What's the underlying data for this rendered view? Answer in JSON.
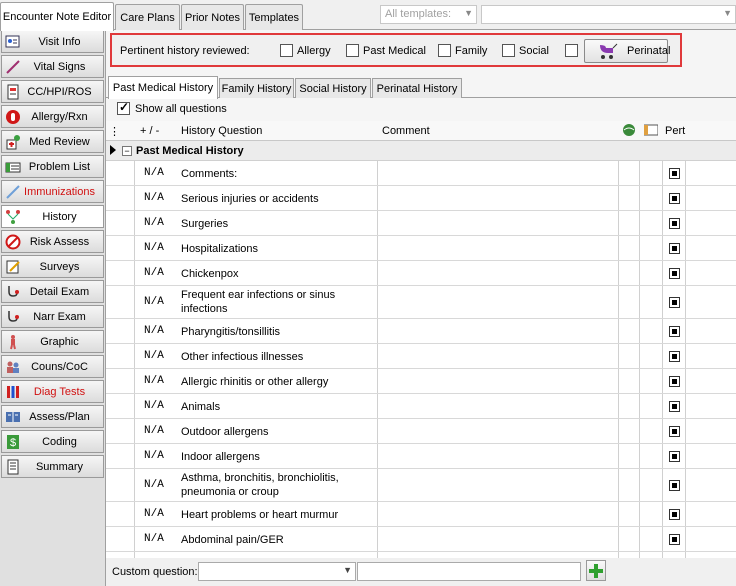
{
  "top_tabs": [
    "Encounter Note Editor",
    "Care Plans",
    "Prior Notes",
    "Templates"
  ],
  "templates_select": {
    "placeholder": "All templates:"
  },
  "sidebar": {
    "items": [
      {
        "label": "Visit Info",
        "icon": "visit-info-icon"
      },
      {
        "label": "Vital Signs",
        "icon": "thermometer-icon"
      },
      {
        "label": "CC/HPI/ROS",
        "icon": "document-icon"
      },
      {
        "label": "Allergy/Rxn",
        "icon": "allergy-icon"
      },
      {
        "label": "Med Review",
        "icon": "medication-icon"
      },
      {
        "label": "Problem List",
        "icon": "list-icon"
      },
      {
        "label": "Immunizations",
        "icon": "syringe-icon"
      },
      {
        "label": "History",
        "icon": "family-tree-icon"
      },
      {
        "label": "Risk Assess",
        "icon": "no-smoking-icon"
      },
      {
        "label": "Surveys",
        "icon": "survey-icon"
      },
      {
        "label": "Detail Exam",
        "icon": "stethoscope-icon"
      },
      {
        "label": "Narr Exam",
        "icon": "stethoscope-icon"
      },
      {
        "label": "Graphic",
        "icon": "body-icon"
      },
      {
        "label": "Couns/CoC",
        "icon": "counseling-icon"
      },
      {
        "label": "Diag Tests",
        "icon": "test-tubes-icon"
      },
      {
        "label": "Assess/Plan",
        "icon": "book-icon"
      },
      {
        "label": "Coding",
        "icon": "dollar-icon"
      },
      {
        "label": "Summary",
        "icon": "summary-icon"
      }
    ],
    "active": "History",
    "red_items": [
      "Immunizations",
      "Diag Tests"
    ]
  },
  "pertinent": {
    "title": "Pertinent history reviewed:",
    "items": [
      "Allergy",
      "Past Medical",
      "Family",
      "Social"
    ],
    "perinatal_button": "Perinatal"
  },
  "sub_tabs": [
    "Past Medical History",
    "Family History",
    "Social History",
    "Perinatal History"
  ],
  "show_all": "Show all questions",
  "grid": {
    "headers": {
      "plus_minus": "+ / -",
      "question": "History Question",
      "comment": "Comment",
      "pert": "Pert"
    },
    "group_title": "Past Medical History",
    "rows": [
      {
        "na": "N/A",
        "q": "Comments:"
      },
      {
        "na": "N/A",
        "q": "Serious injuries or accidents"
      },
      {
        "na": "N/A",
        "q": "Surgeries"
      },
      {
        "na": "N/A",
        "q": "Hospitalizations"
      },
      {
        "na": "N/A",
        "q": "Chickenpox"
      },
      {
        "na": "N/A",
        "q": "Frequent ear infections or sinus infections"
      },
      {
        "na": "N/A",
        "q": "Pharyngitis/tonsillitis"
      },
      {
        "na": "N/A",
        "q": "Other infectious illnesses"
      },
      {
        "na": "N/A",
        "q": "Allergic rhinitis or other allergy"
      },
      {
        "na": "N/A",
        "q": "Animals"
      },
      {
        "na": "N/A",
        "q": "Outdoor allergens"
      },
      {
        "na": "N/A",
        "q": "Indoor allergens"
      },
      {
        "na": "N/A",
        "q": "Asthma, bronchitis, bronchiolitis, pneumonia or croup"
      },
      {
        "na": "N/A",
        "q": "Heart problems or heart murmur"
      },
      {
        "na": "N/A",
        "q": "Abdominal pain/GER"
      }
    ]
  },
  "bottom": {
    "custom_label": "Custom question:"
  },
  "colors": {
    "highlight_border": "#e0393b",
    "red_text": "#d01010"
  }
}
